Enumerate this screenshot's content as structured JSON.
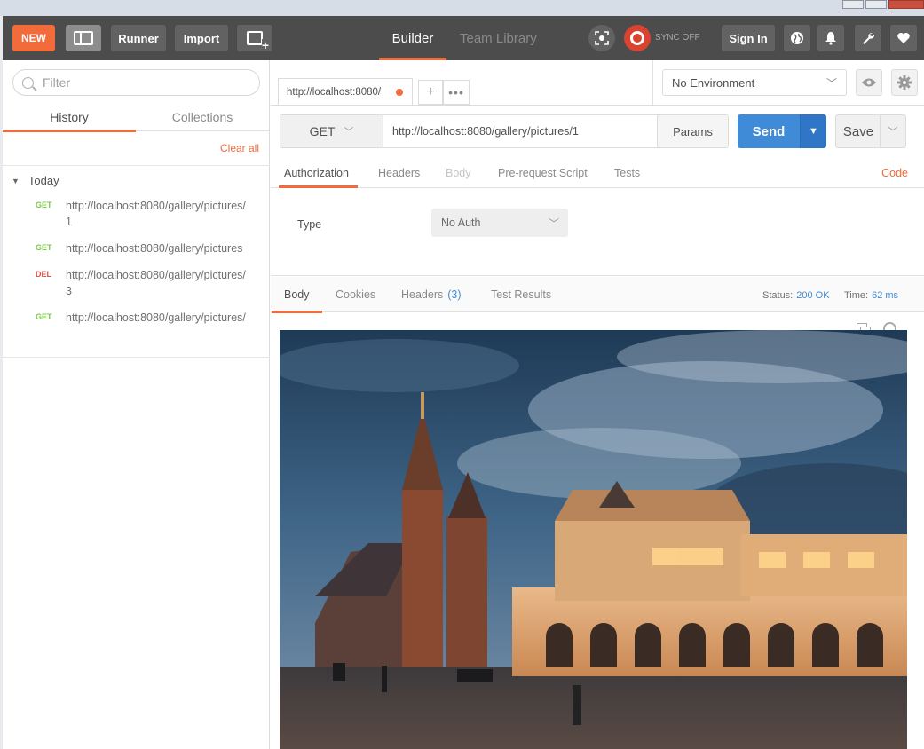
{
  "topbar": {
    "new_label": "NEW",
    "runner_label": "Runner",
    "import_label": "Import",
    "tab_builder": "Builder",
    "tab_team": "Team Library",
    "sync_label": "SYNC OFF",
    "signin_label": "Sign In"
  },
  "sidebar": {
    "filter_placeholder": "Filter",
    "tab_history": "History",
    "tab_collections": "Collections",
    "clear_all": "Clear all",
    "group_label": "Today",
    "items": [
      {
        "method": "GET",
        "url": "http://localhost:8080/gallery/pictures/1"
      },
      {
        "method": "GET",
        "url": "http://localhost:8080/gallery/pictures"
      },
      {
        "method": "DEL",
        "url": "http://localhost:8080/gallery/pictures/3"
      },
      {
        "method": "GET",
        "url": "http://localhost:8080/gallery/pictures/"
      }
    ]
  },
  "request": {
    "tab_title": "http://localhost:8080/",
    "method": "GET",
    "url": "http://localhost:8080/gallery/pictures/1",
    "params_label": "Params",
    "send_label": "Send",
    "save_label": "Save",
    "tabs": [
      "Authorization",
      "Headers",
      "Body",
      "Pre-request Script",
      "Tests"
    ],
    "code_link": "Code",
    "auth_type_label": "Type",
    "auth_type_value": "No Auth"
  },
  "environment": {
    "selected": "No Environment"
  },
  "response": {
    "tabs": [
      "Body",
      "Cookies",
      "Headers",
      "Test Results"
    ],
    "headers_count": "(3)",
    "status_label": "Status:",
    "status_value": "200 OK",
    "time_label": "Time:",
    "time_value": "62 ms"
  },
  "colors": {
    "accent": "#f26b3a",
    "send": "#3f8bd8",
    "topbar": "#4c4c4c"
  }
}
